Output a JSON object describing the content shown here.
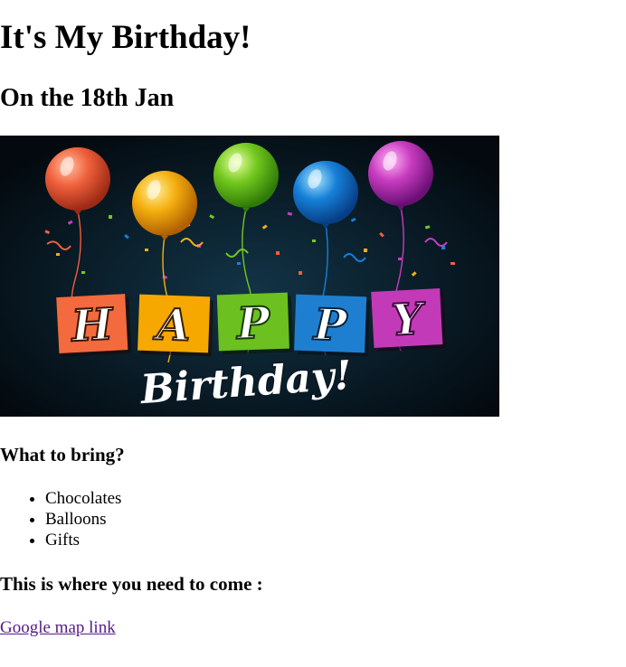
{
  "page": {
    "title": "It's My Birthday!",
    "subtitle": "On the 18th Jan"
  },
  "banner": {
    "happy_letters": [
      "H",
      "A",
      "P",
      "P",
      "Y"
    ],
    "script_text": "Birthday!",
    "background_color": "#07141f",
    "letter_colors": [
      "#f26a3d",
      "#f7a800",
      "#6cc020",
      "#1e7fd0",
      "#c23ab8"
    ],
    "balloon_colors": [
      "#f0603c",
      "#f5b010",
      "#72c81e",
      "#1680d8",
      "#c83cc0"
    ]
  },
  "bring": {
    "heading": "What to bring?",
    "items": [
      "Chocolates",
      "Balloons",
      "Gifts"
    ]
  },
  "location": {
    "heading": "This is where you need to come :",
    "link_text": "Google map link",
    "link_color": "#551a8b"
  }
}
